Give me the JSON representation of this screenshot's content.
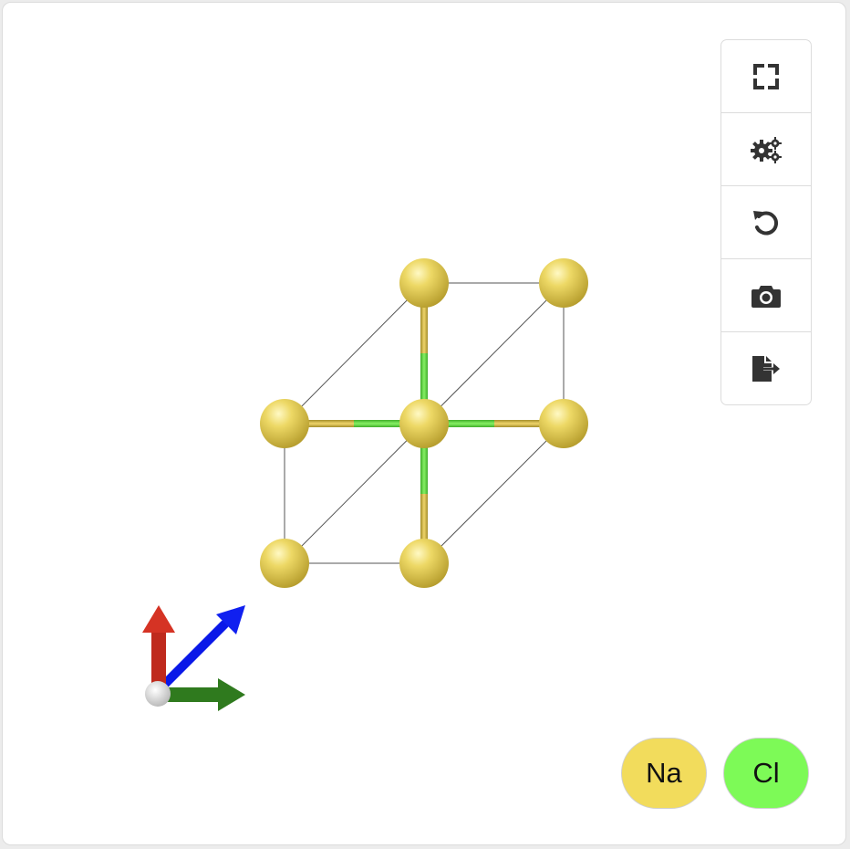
{
  "toolbar": {
    "buttons": [
      {
        "name": "fullscreen-button",
        "icon": "fullscreen-icon"
      },
      {
        "name": "settings-button",
        "icon": "gears-icon"
      },
      {
        "name": "reset-view-button",
        "icon": "rotate-left-icon"
      },
      {
        "name": "screenshot-button",
        "icon": "camera-icon"
      },
      {
        "name": "export-button",
        "icon": "file-export-icon"
      }
    ]
  },
  "legend": {
    "na": {
      "label": "Na",
      "color": "#f2dc5c"
    },
    "cl": {
      "label": "Cl",
      "color": "#7dfa57"
    }
  },
  "colors": {
    "sodium": "#e6d05c",
    "chlorine": "#6fe04a",
    "axis_x": "#cf2b1f",
    "axis_y": "#2f7a1e",
    "axis_z": "#0a18e8",
    "icon": "#333333"
  }
}
